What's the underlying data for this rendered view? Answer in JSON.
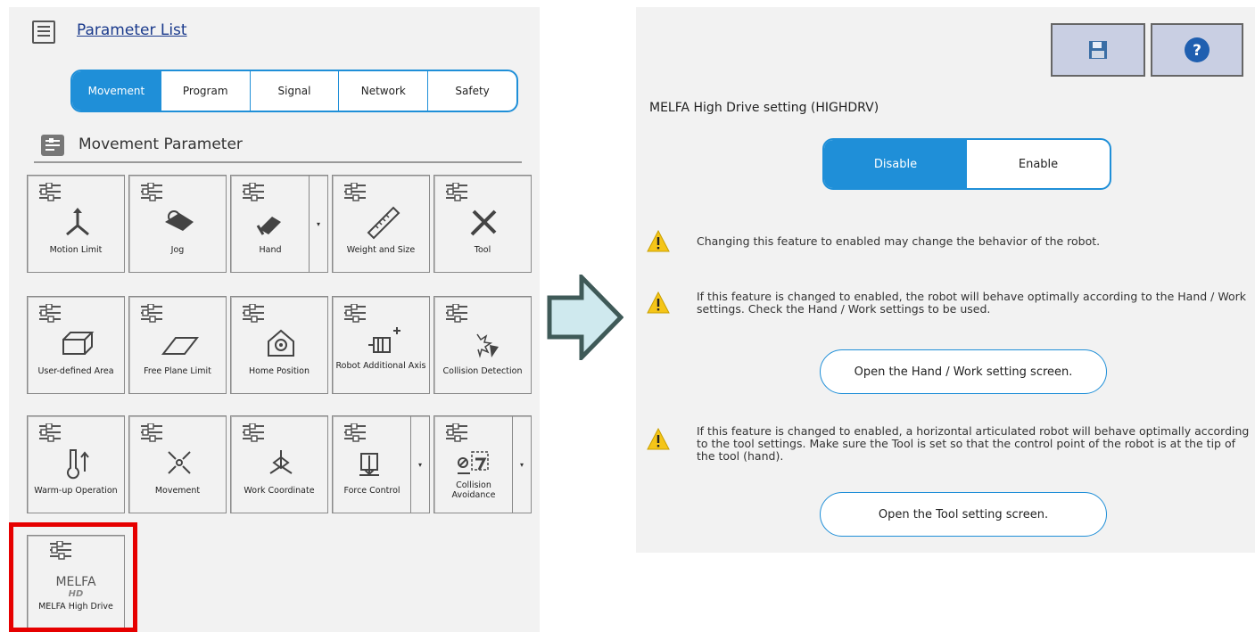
{
  "left": {
    "title": "Parameter List",
    "tabs": [
      "Movement",
      "Program",
      "Signal",
      "Network",
      "Safety"
    ],
    "active_tab": "Movement",
    "section_title": "Movement Parameter",
    "tiles": {
      "motion_limit": "Motion Limit",
      "jog": "Jog",
      "hand": "Hand",
      "weight_size": "Weight and Size",
      "tool": "Tool",
      "user_area": "User-defined Area",
      "free_plane": "Free Plane Limit",
      "home_position": "Home Position",
      "robot_axis": "Robot Additional Axis",
      "collision_detection": "Collision Detection",
      "warmup": "Warm-up Operation",
      "movement": "Movement",
      "work_coordinate": "Work Coordinate",
      "force_control": "Force Control",
      "collision_avoidance": "Collision Avoidance",
      "melfa_high_drive": "MELFA High Drive",
      "melfa_logo": "MELFA",
      "melfa_hd": "HD"
    }
  },
  "right": {
    "setting_title": "MELFA High Drive setting (HIGHDRV)",
    "toggle": {
      "disable": "Disable",
      "enable": "Enable",
      "selected": "Disable"
    },
    "warning1": "Changing this feature to enabled may change the behavior of the robot.",
    "warning2": "If this feature is changed to enabled, the robot will behave optimally according to the Hand / Work settings. Check the Hand / Work settings to be used.",
    "hand_work_button": "Open the Hand / Work setting screen.",
    "warning3": "If this feature is changed to enabled, a horizontal articulated robot will behave optimally according to the tool settings. Make sure the Tool is set so that the control point of the robot is at the tip of the tool (hand).",
    "tool_button": "Open the Tool setting screen."
  },
  "icons": [
    "list-icon",
    "save-icon",
    "help-icon",
    "warning-icon",
    "arrow-right-icon"
  ],
  "colors": {
    "accent": "#1f8fd8",
    "highlight": "#e60000",
    "arrow_fill": "#cfe9ee",
    "arrow_stroke": "#3f5a58",
    "warning": "#f5c518"
  }
}
